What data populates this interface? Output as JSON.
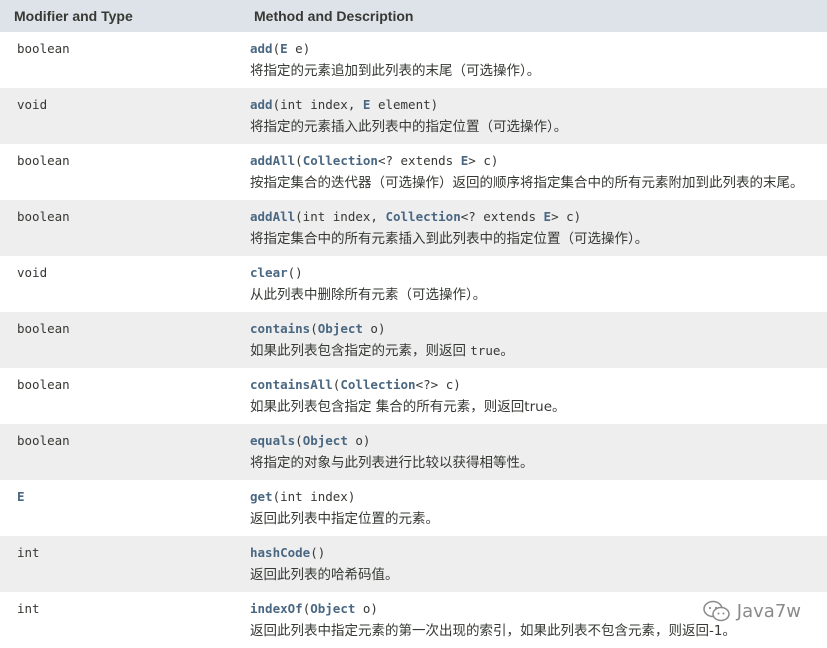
{
  "header": {
    "col1": "Modifier and Type",
    "col2": "Method and Description"
  },
  "rows": [
    {
      "type": "boolean",
      "name": "add",
      "params": [
        {
          "t": "(",
          "l": false
        },
        {
          "t": "E",
          "l": true
        },
        {
          "t": " e)",
          "l": false
        }
      ],
      "desc": "将指定的元素追加到此列表的末尾（可选操作）。"
    },
    {
      "type": "void",
      "name": "add",
      "params": [
        {
          "t": "(int index, ",
          "l": false
        },
        {
          "t": "E",
          "l": true
        },
        {
          "t": " element)",
          "l": false
        }
      ],
      "desc": "将指定的元素插入此列表中的指定位置（可选操作）。"
    },
    {
      "type": "boolean",
      "name": "addAll",
      "params": [
        {
          "t": "(",
          "l": false
        },
        {
          "t": "Collection",
          "l": true
        },
        {
          "t": "<? extends ",
          "l": false
        },
        {
          "t": "E",
          "l": true
        },
        {
          "t": "> c)",
          "l": false
        }
      ],
      "desc": "按指定集合的迭代器（可选操作）返回的顺序将指定集合中的所有元素附加到此列表的末尾。"
    },
    {
      "type": "boolean",
      "name": "addAll",
      "params": [
        {
          "t": "(int index, ",
          "l": false
        },
        {
          "t": "Collection",
          "l": true
        },
        {
          "t": "<? extends ",
          "l": false
        },
        {
          "t": "E",
          "l": true
        },
        {
          "t": "> c)",
          "l": false
        }
      ],
      "desc": "将指定集合中的所有元素插入到此列表中的指定位置（可选操作）。"
    },
    {
      "type": "void",
      "name": "clear",
      "params": [
        {
          "t": "()",
          "l": false
        }
      ],
      "desc": "从此列表中删除所有元素（可选操作）。"
    },
    {
      "type": "boolean",
      "name": "contains",
      "params": [
        {
          "t": "(",
          "l": false
        },
        {
          "t": "Object",
          "l": true
        },
        {
          "t": " o)",
          "l": false
        }
      ],
      "desc": "如果此列表包含指定的元素，则返回 ",
      "desc_code": "true",
      "desc_after": "。"
    },
    {
      "type": "boolean",
      "name": "containsAll",
      "params": [
        {
          "t": "(",
          "l": false
        },
        {
          "t": "Collection",
          "l": true
        },
        {
          "t": "<?> c)",
          "l": false
        }
      ],
      "desc": "如果此列表包含指定 集合的所有元素，则返回true。"
    },
    {
      "type": "boolean",
      "name": "equals",
      "params": [
        {
          "t": "(",
          "l": false
        },
        {
          "t": "Object",
          "l": true
        },
        {
          "t": " o)",
          "l": false
        }
      ],
      "desc": "将指定的对象与此列表进行比较以获得相等性。"
    },
    {
      "type": "E",
      "type_link": true,
      "name": "get",
      "params": [
        {
          "t": "(int index)",
          "l": false
        }
      ],
      "desc": "返回此列表中指定位置的元素。"
    },
    {
      "type": "int",
      "name": "hashCode",
      "params": [
        {
          "t": "()",
          "l": false
        }
      ],
      "desc": "返回此列表的哈希码值。"
    },
    {
      "type": "int",
      "name": "indexOf",
      "params": [
        {
          "t": "(",
          "l": false
        },
        {
          "t": "Object",
          "l": true
        },
        {
          "t": " o)",
          "l": false
        }
      ],
      "desc": "返回此列表中指定元素的第一次出现的索引，如果此列表不包含元素，则返回-1。"
    }
  ],
  "watermark": "Java7w"
}
